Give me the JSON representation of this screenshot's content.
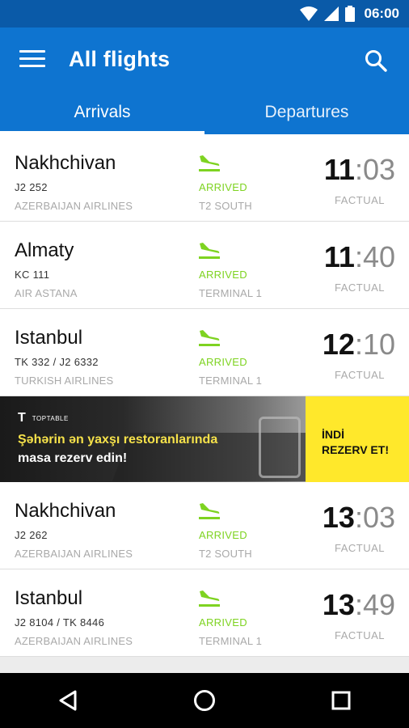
{
  "status_bar": {
    "time": "06:00"
  },
  "app_bar": {
    "title": "All flights"
  },
  "tabs": [
    {
      "label": "Arrivals",
      "active": true
    },
    {
      "label": "Departures",
      "active": false
    }
  ],
  "flights": [
    {
      "city": "Nakhchivan",
      "flight": "J2 252",
      "airline": "AZERBAIJAN AIRLINES",
      "status": "ARRIVED",
      "terminal": "T2 SOUTH",
      "time_hour": "11",
      "time_min": "03",
      "time_type": "FACTUAL"
    },
    {
      "city": "Almaty",
      "flight": "KC 111",
      "airline": "AIR ASTANA",
      "status": "ARRIVED",
      "terminal": "TERMINAL 1",
      "time_hour": "11",
      "time_min": "40",
      "time_type": "FACTUAL"
    },
    {
      "city": "Istanbul",
      "flight": "TK 332 / J2 6332",
      "airline": "TURKISH AIRLINES",
      "status": "ARRIVED",
      "terminal": "TERMINAL 1",
      "time_hour": "12",
      "time_min": "10",
      "time_type": "FACTUAL"
    },
    {
      "city": "Nakhchivan",
      "flight": "J2 262",
      "airline": "AZERBAIJAN AIRLINES",
      "status": "ARRIVED",
      "terminal": "T2 SOUTH",
      "time_hour": "13",
      "time_min": "03",
      "time_type": "FACTUAL"
    },
    {
      "city": "Istanbul",
      "flight": "J2 8104 / TK 8446",
      "airline": "AZERBAIJAN AIRLINES",
      "status": "ARRIVED",
      "terminal": "TERMINAL 1",
      "time_hour": "13",
      "time_min": "49",
      "time_type": "FACTUAL"
    }
  ],
  "ad": {
    "brand": "TOPTABLE",
    "line1": "Şəhərin ən yaxşı restoranlarında",
    "line2": "masa rezerv edin!",
    "cta_line1": "İNDİ",
    "cta_line2": "REZERV ET!"
  },
  "colors": {
    "primary": "#0e74d0",
    "status_bar": "#0a5aa8",
    "arrived": "#7ed321",
    "ad_cta": "#ffe82b"
  }
}
